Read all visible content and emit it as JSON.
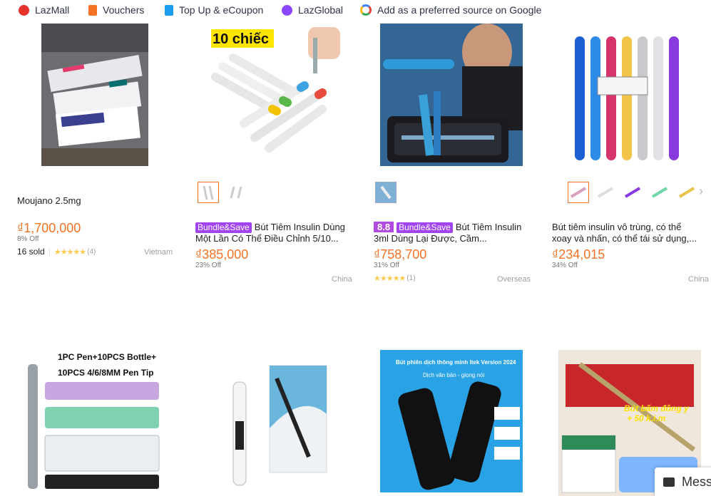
{
  "topbar": {
    "items": [
      {
        "label": "LazMall",
        "icon": "lazmall-icon",
        "color": "#e5322d"
      },
      {
        "label": "Vouchers",
        "icon": "voucher-icon",
        "color": "#f57224"
      },
      {
        "label": "Top Up & eCoupon",
        "icon": "topup-icon",
        "color": "#1a9cf0"
      },
      {
        "label": "LazGlobal",
        "icon": "lazglobal-icon",
        "color": "#8b46ff"
      },
      {
        "label": "Add as a preferred source on Google",
        "icon": "google-icon",
        "color": "#4285f4"
      }
    ]
  },
  "products": [
    {
      "title": "Moujano 2.5mg",
      "price": "₫1,700,000",
      "discount": "8% Off",
      "sold": "16 sold",
      "rating_count": "(4)",
      "location": "Vietnam"
    },
    {
      "badge": "Bundle&Save",
      "title": "Bút Tiêm Insulin Dùng Một Lần Có Thể Điều Chỉnh 5/10...",
      "price": "₫385,000",
      "discount": "23% Off",
      "location": "China",
      "image_text": "10 chiếc"
    },
    {
      "badge_num": "8.8",
      "badge": "Bundle&Save",
      "title": "Bút Tiêm Insulin 3ml Dùng Lại Được, Cầm...",
      "price": "₫758,700",
      "discount": "31% Off",
      "rating_count": "(1)",
      "location": "Overseas"
    },
    {
      "title": "Bút tiêm insulin vô trùng, có thể xoay và nhấn, có thể tái sử dụng,...",
      "price": "₫234,015",
      "discount": "34% Off",
      "location": "China"
    }
  ],
  "row2": [
    {
      "image_text": "1PC Pen+10PCS Bottle+ 10PCS 4/6/8MM Pen Tip"
    },
    {
      "image_text": ""
    },
    {
      "image_text": "Bút phiên dịch thông minh Itek Version 2024",
      "image_sub": "Dịch văn bản - giọng nói"
    },
    {
      "image_text": "Bút bấm đông y + 50 k.i.m"
    }
  ],
  "chat": {
    "label": "Mess"
  }
}
